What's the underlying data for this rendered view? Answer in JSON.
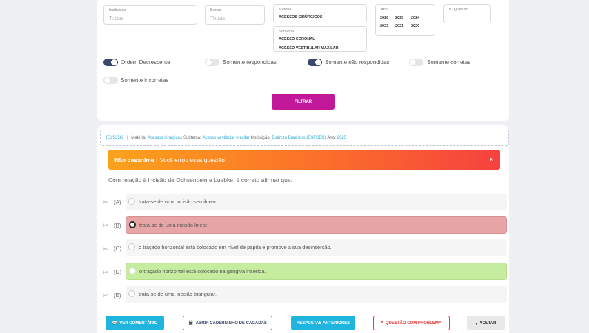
{
  "filters": {
    "instituicao": {
      "label": "Instituição",
      "placeholder": "Todas"
    },
    "banca": {
      "label": "Banca",
      "placeholder": "Todas"
    },
    "materia": {
      "label": "Matéria",
      "value": "ACESSOS CIRÚRGICOS"
    },
    "subtema": {
      "label": "Subtema",
      "values": [
        "ACESSO CORONAL",
        "ACESSO VESTIBULAR MAXILAR"
      ]
    },
    "ano": {
      "label": "Ano",
      "years": [
        "2026",
        "2025",
        "2024",
        "2023",
        "2021",
        "2020"
      ]
    },
    "id_questao": {
      "label": "ID Questão"
    }
  },
  "toggles": [
    {
      "label": "Ordem Decrescente",
      "on": true
    },
    {
      "label": "Somente respondidas",
      "on": false
    },
    {
      "label": "Somente não respondidas",
      "on": true
    },
    {
      "label": "Somente corretas",
      "on": false
    },
    {
      "label": "Somente incorretas",
      "on": false
    }
  ],
  "filter_button": "FILTRAR",
  "meta": {
    "id": "[Q25356]",
    "sep": "|",
    "materia_k": "Matéria:",
    "materia_v": "Acessos cirúrgicos",
    "subtema_k": "Subtema:",
    "subtema_v": "Acesso vestibular maxilar",
    "inst_k": "Instituição:",
    "inst_v": "Exército Brasileiro (ESFCEX)",
    "ano_k": "Ano:",
    "ano_v": "2025"
  },
  "alert": {
    "strong": "Não desanime !",
    "text": "Você errou essa questão.",
    "close": "×"
  },
  "question": "Com relação à incisão de Ochsenbein e Luebke, é correto afirmar que:",
  "options": [
    {
      "letter": "(A)",
      "text": "trata-se de uma incisão semilunar.",
      "state": "normal"
    },
    {
      "letter": "(B)",
      "text": "trata-se de uma incisão linear.",
      "state": "wrong"
    },
    {
      "letter": "(C)",
      "text": "o traçado horizontal está colocado em nível de papila e promove a sua desinserção.",
      "state": "normal"
    },
    {
      "letter": "(D)",
      "text": "o traçado horizontal está colocado na gengiva inserida.",
      "state": "correct"
    },
    {
      "letter": "(E)",
      "text": "trata-se de uma incisão triangular.",
      "state": "normal"
    }
  ],
  "actions": {
    "ver_comentario": "VER COMENTÁRIO",
    "caderninho": "ABRIR CADERNINHO DE CAGADAS",
    "respostas": "RESPOSTAS ANTERIORES",
    "problema": "QUESTÃO COM PROBLEMA",
    "voltar": "VOLTAR"
  },
  "icons": {
    "scissor": "✂",
    "comment": "💬",
    "book": "📓",
    "alert": "*",
    "back": "‹"
  },
  "colors": {
    "accent": "#c2189a",
    "cyan": "#20b5df",
    "wrong": "#e8a5a6",
    "correct": "#c6ed9f"
  }
}
